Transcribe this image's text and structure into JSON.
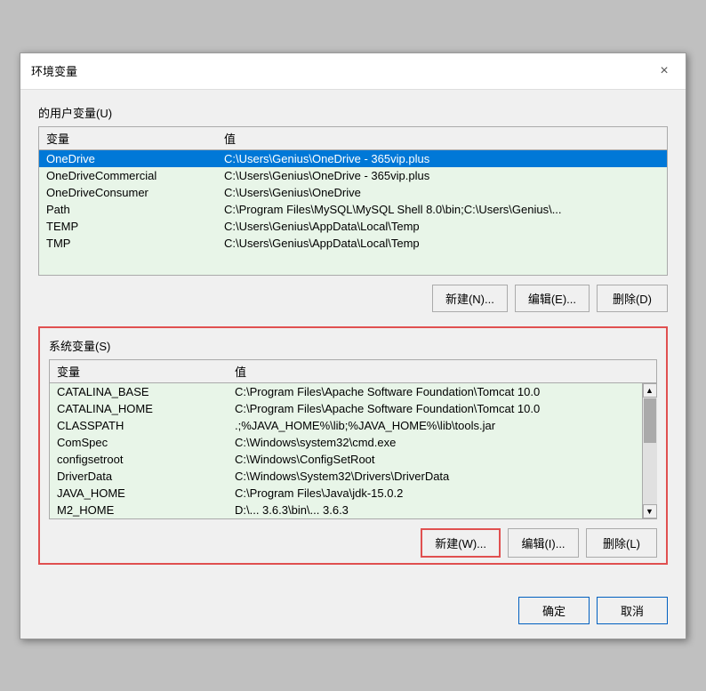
{
  "title_bar": {
    "title": "环境变量",
    "close_label": "×"
  },
  "user_section": {
    "label": "       的用户变量(U)",
    "columns": {
      "var": "变量",
      "val": "值"
    },
    "rows": [
      {
        "var": "OneDrive",
        "val": "C:\\Users\\Genius\\OneDrive - 365vip.plus",
        "selected": true
      },
      {
        "var": "OneDriveCommercial",
        "val": "C:\\Users\\Genius\\OneDrive - 365vip.plus",
        "selected": false
      },
      {
        "var": "OneDriveConsumer",
        "val": "C:\\Users\\Genius\\OneDrive",
        "selected": false
      },
      {
        "var": "Path",
        "val": "C:\\Program Files\\MySQL\\MySQL Shell 8.0\\bin;C:\\Users\\Genius\\...",
        "selected": false
      },
      {
        "var": "TEMP",
        "val": "C:\\Users\\Genius\\AppData\\Local\\Temp",
        "selected": false
      },
      {
        "var": "TMP",
        "val": "C:\\Users\\Genius\\AppData\\Local\\Temp",
        "selected": false
      }
    ],
    "buttons": {
      "new": "新建(N)...",
      "edit": "编辑(E)...",
      "delete": "删除(D)"
    }
  },
  "sys_section": {
    "label": "系统变量(S)",
    "columns": {
      "var": "变量",
      "val": "值"
    },
    "rows": [
      {
        "var": "CATALINA_BASE",
        "val": "C:\\Program Files\\Apache Software Foundation\\Tomcat 10.0",
        "selected": false
      },
      {
        "var": "CATALINA_HOME",
        "val": "C:\\Program Files\\Apache Software Foundation\\Tomcat 10.0",
        "selected": false
      },
      {
        "var": "CLASSPATH",
        "val": ".;%JAVA_HOME%\\lib;%JAVA_HOME%\\lib\\tools.jar",
        "selected": false
      },
      {
        "var": "ComSpec",
        "val": "C:\\Windows\\system32\\cmd.exe",
        "selected": false
      },
      {
        "var": "configsetroot",
        "val": "C:\\Windows\\ConfigSetRoot",
        "selected": false
      },
      {
        "var": "DriverData",
        "val": "C:\\Windows\\System32\\Drivers\\DriverData",
        "selected": false
      },
      {
        "var": "JAVA_HOME",
        "val": "C:\\Program Files\\Java\\jdk-15.0.2",
        "selected": false
      },
      {
        "var": "M2_HOME",
        "val": "D:\\...  3.6.3\\bin\\...  3.6.3",
        "selected": false
      }
    ],
    "buttons": {
      "new": "新建(W)...",
      "edit": "编辑(I)...",
      "delete": "删除(L)"
    }
  },
  "bottom_buttons": {
    "ok": "确定",
    "cancel": "取消"
  }
}
